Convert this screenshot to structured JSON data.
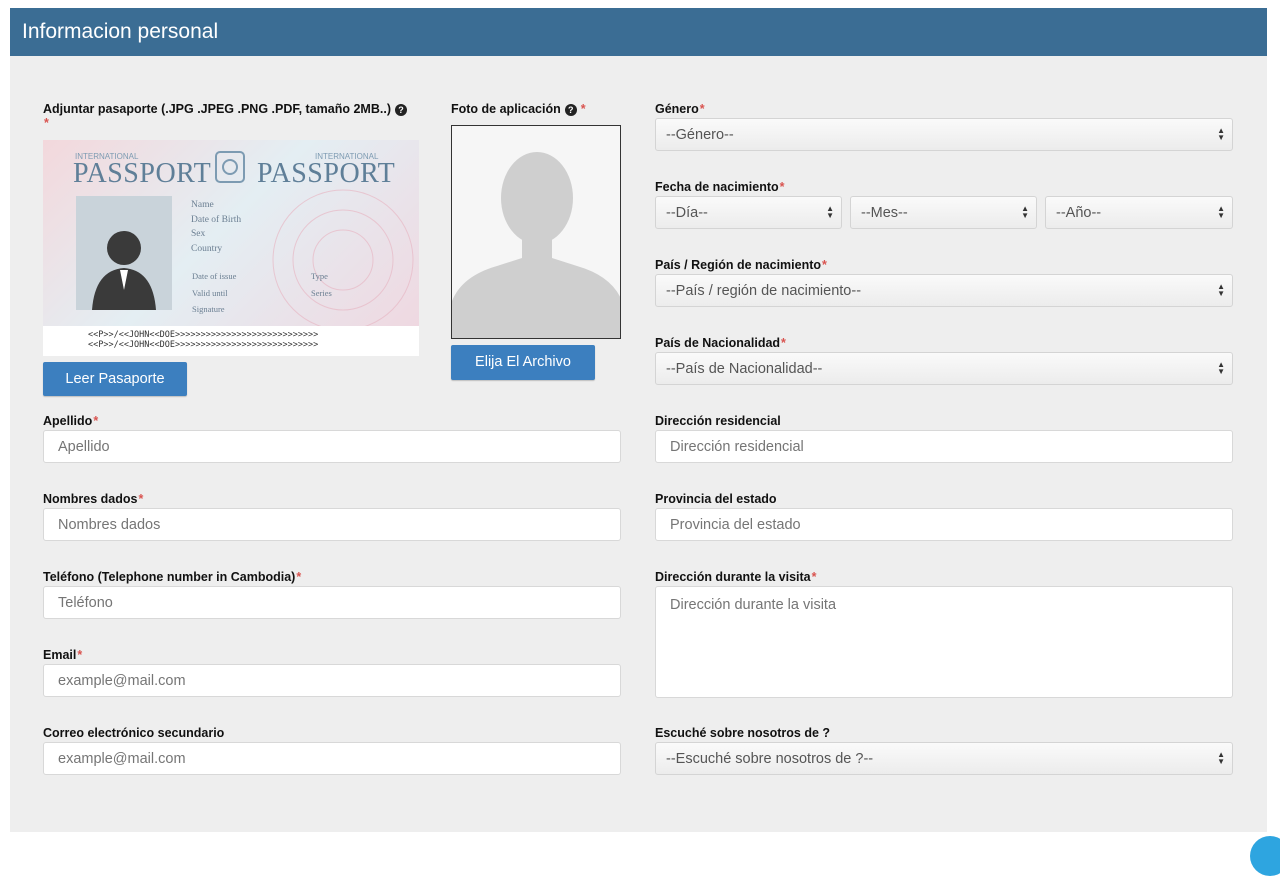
{
  "header": {
    "title": "Informacion personal"
  },
  "passport_upload": {
    "label": "Adjuntar pasaporte (.JPG .JPEG .PNG .PDF, tamaño 2MB..)",
    "required_mark": "*",
    "help_glyph": "?",
    "button_label": "Leer Pasaporte",
    "sample": {
      "brand_small": "INTERNATIONAL",
      "brand_big": "PASSPORT",
      "fields": [
        "Name",
        "Date of Birth",
        "Sex",
        "Country"
      ],
      "fields2": [
        "Date of issue",
        "Valid until",
        "Signature"
      ],
      "fields3": [
        "Type",
        "Series"
      ],
      "mrz_line1": "<<P>>/<<JOHN<<DOE>>>>>>>>>>>>>>>>>>>>>>>>>>>>",
      "mrz_line2": "<<P>>/<<JOHN<<DOE>>>>>>>>>>>>>>>>>>>>>>>>>>>>"
    }
  },
  "photo_upload": {
    "label": "Foto de aplicación",
    "required_mark": "*",
    "help_glyph": "?",
    "button_label": "Elija El Archivo"
  },
  "left_fields": {
    "apellido": {
      "label": "Apellido",
      "required_mark": "*",
      "placeholder": "Apellido"
    },
    "nombres": {
      "label": "Nombres dados",
      "required_mark": "*",
      "placeholder": "Nombres dados"
    },
    "telefono": {
      "label": "Teléfono (Telephone number in Cambodia)",
      "required_mark": "*",
      "placeholder": "Teléfono"
    },
    "email": {
      "label": "Email",
      "required_mark": "*",
      "placeholder": "example@mail.com"
    },
    "email2": {
      "label": "Correo electrónico secundario",
      "placeholder": "example@mail.com"
    }
  },
  "right_fields": {
    "genero": {
      "label": "Género",
      "required_mark": "*",
      "selected": "--Género--"
    },
    "nacimiento": {
      "label": "Fecha de nacimiento",
      "required_mark": "*",
      "dia": "--Día--",
      "mes": "--Mes--",
      "anio": "--Año--"
    },
    "pais_nac": {
      "label": "País / Región de nacimiento",
      "required_mark": "*",
      "selected": "--País / región de nacimiento--"
    },
    "nacionalidad": {
      "label": "País de Nacionalidad",
      "required_mark": "*",
      "selected": "--País de Nacionalidad--"
    },
    "direccion": {
      "label": "Dirección residencial",
      "placeholder": "Dirección residencial"
    },
    "provincia": {
      "label": "Provincia del estado",
      "placeholder": "Provincia del estado"
    },
    "direccion_visita": {
      "label": "Dirección durante la visita",
      "required_mark": "*",
      "placeholder": "Dirección durante la visita"
    },
    "escuche": {
      "label": "Escuché sobre nosotros de ?",
      "selected": "--Escuché sobre nosotros de ?--"
    }
  },
  "colors": {
    "header": "#3b6d94",
    "button": "#3c7fbf",
    "required": "#d9534f",
    "panel": "#eeeeee"
  }
}
